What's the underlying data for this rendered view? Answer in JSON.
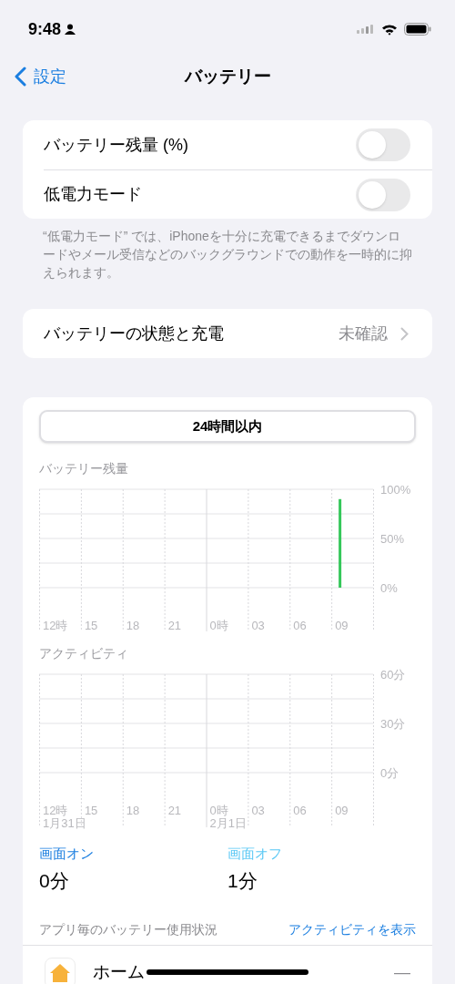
{
  "status_bar": {
    "time": "9:48"
  },
  "nav": {
    "back": "設定",
    "title": "バッテリー"
  },
  "settings": [
    {
      "label": "バッテリー残量 (%)",
      "on": false
    },
    {
      "label": "低電力モード",
      "on": false
    }
  ],
  "footer": "“低電力モード” では、iPhoneを十分に充電できるまでダウンロードやメール受信などのバックグラウンドでの動作を一時的に抑えられます。",
  "health": {
    "label": "バッテリーの状態と充電",
    "value": "未確認"
  },
  "range_tabs": [
    {
      "label": "24時間以内",
      "selected": true
    }
  ],
  "battery_chart": {
    "chart_data": {
      "type": "bar",
      "title": "バッテリー残量",
      "categories": [
        "12時",
        "15",
        "18",
        "21",
        "0時",
        "03",
        "06",
        "09"
      ],
      "series": [
        {
          "color": "#34c759",
          "values": [
            null,
            null,
            null,
            null,
            null,
            null,
            null,
            90
          ]
        }
      ],
      "ref_lines": [
        {
          "axis": "x",
          "value": "0時"
        }
      ],
      "ylim": [
        0,
        100
      ],
      "yticks": [
        {
          "value": 0,
          "label": "0%"
        },
        {
          "value": 50,
          "label": "50%"
        },
        {
          "value": 100,
          "label": "100%"
        }
      ]
    }
  },
  "activity_chart": {
    "chart_data": {
      "type": "bar",
      "title": "アクティビティ",
      "categories": [
        "12時",
        "15",
        "18",
        "21",
        "0時",
        "03",
        "06",
        "09"
      ],
      "series": [
        {
          "values": [
            0,
            0,
            0,
            0,
            0,
            0,
            0,
            0
          ]
        }
      ],
      "ref_lines": [
        {
          "axis": "x",
          "value": "0時"
        }
      ],
      "ylim": [
        0,
        60
      ],
      "yticks": [
        {
          "value": 0,
          "label": "0分"
        },
        {
          "value": 30,
          "label": "30分"
        },
        {
          "value": 60,
          "label": "60分"
        }
      ]
    },
    "dates": [
      "1月31日",
      "2月1日"
    ]
  },
  "screen": [
    {
      "label": "画面オン",
      "value": "0分",
      "color": "#1a7ee0"
    },
    {
      "label": "画面オフ",
      "value": "1分",
      "color": "#5ac8f5"
    }
  ],
  "usage": {
    "title": "アプリ毎のバッテリー使用状況",
    "link": "アクティビティを表示"
  },
  "apps": [
    {
      "name": "ホーム",
      "usage": "—"
    }
  ]
}
